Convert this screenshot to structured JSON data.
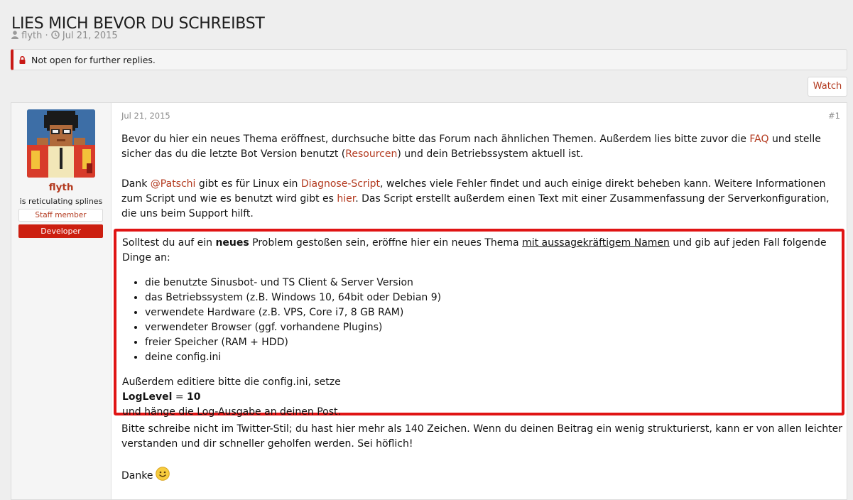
{
  "thread": {
    "title": "LIES MICH BEVOR DU SCHREIBST",
    "author": "flyth",
    "separator": "·",
    "date": "Jul 21, 2015"
  },
  "notice": {
    "text": "Not open for further replies."
  },
  "toolbar": {
    "watch_label": "Watch"
  },
  "post": {
    "date": "Jul 21, 2015",
    "number": "#1",
    "user": {
      "name": "flyth",
      "title": "is reticulating splines",
      "badge_staff": "Staff member",
      "badge_dev": "Developer"
    },
    "p1": {
      "a": "Bevor du hier ein neues Thema eröffnest, durchsuche bitte das Forum nach ähnlichen Themen. Außerdem lies bitte zuvor die ",
      "faq": "FAQ",
      "b": " und stelle sicher das du die letzte Bot Version benutzt (",
      "resourcen": "Resourcen",
      "c": ") und dein Betriebssystem aktuell ist."
    },
    "p2": {
      "a": "Dank ",
      "mention": "@Patschi",
      "b": " gibt es für Linux ein ",
      "diag": "Diagnose-Script",
      "c": ", welches viele Fehler findet und auch einige direkt beheben kann. Weitere Informationen zum Script und wie es benutzt wird gibt es ",
      "hier": "hier",
      "d": ". Das Script erstellt außerdem einen Text mit einer Zusammenfassung der Serverkonfiguration, die uns beim Support hilft."
    },
    "box": {
      "intro_a": "Solltest du auf ein ",
      "intro_bold": "neues",
      "intro_b": " Problem gestoßen sein, eröffne hier ein neues Thema ",
      "intro_underline": "mit aussagekräftigem Namen",
      "intro_c": " und gib auf jeden Fall folgende Dinge an:",
      "items": [
        "die benutzte Sinusbot- und TS Client & Server Version",
        "das Betriebssystem (z.B. Windows 10, 64bit oder Debian 9)",
        "verwendete Hardware (z.B. VPS, Core i7, 8 GB RAM)",
        "verwendeter Browser (ggf. vorhandene Plugins)",
        "freier Speicher (RAM + HDD)",
        "deine config.ini"
      ],
      "after_line1": "Außerdem editiere bitte die config.ini, setze",
      "loglevel_key": "LogLevel",
      "loglevel_eq": " = ",
      "loglevel_value": "10",
      "after_line3": "und hänge die Log-Ausgabe an deinen Post."
    },
    "p3": "Bitte schreibe nicht im Twitter-Stil; du hast hier mehr als 140 Zeichen. Wenn du deinen Beitrag ein wenig strukturierst, kann er von allen leichter verstanden und dir schneller geholfen werden. Sei höflich!",
    "p4": "Danke"
  },
  "colors": {
    "accent": "#b33a1f",
    "highlight_border": "#e01414",
    "developer_badge": "#cc1f10",
    "notice_border": "#c91a16"
  },
  "icons": {
    "author": "user-icon",
    "date": "clock-icon",
    "notice": "lock-icon",
    "emoji": "smiley-icon"
  }
}
